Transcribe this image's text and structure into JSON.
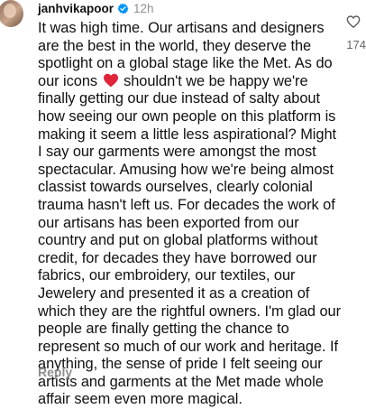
{
  "comment": {
    "username": "janhvikapoor",
    "timestamp": "12h",
    "text_before_icon": "It was high time. Our artisans and designers are the best in the world, they deserve the spotlight on a global stage like the Met. As do our icons ",
    "text_after_icon": " shouldn't we be happy we're finally getting our due instead of salty about how seeing our own people on this platform is making it seem a little less aspirational? Might I say our garments were amongst the most spectacular. Amusing how we're being almost classist towards ourselves, clearly colonial trauma hasn't left us. For decades the work of our artisans has been exported from our country and put on global platforms without credit, for decades they have borrowed our fabrics, our embroidery, our textiles, our Jewelery and presented it as a creation of which they are the rightful owners. I'm glad our people are finally getting the chance to represent so much of our work and heritage. If anything, the sense of pride I felt seeing our artists and garments at the Met made whole affair seem even more magical.",
    "inline_icon": "red-heart-emoji",
    "reply_label": "Reply",
    "like_count": "174",
    "like_icon": "heart-outline-icon",
    "verified_icon": "verified-badge-icon"
  },
  "colors": {
    "verified_blue": "#0095f6",
    "heart_red": "#e0243a",
    "muted_text": "#8e8e8e"
  }
}
